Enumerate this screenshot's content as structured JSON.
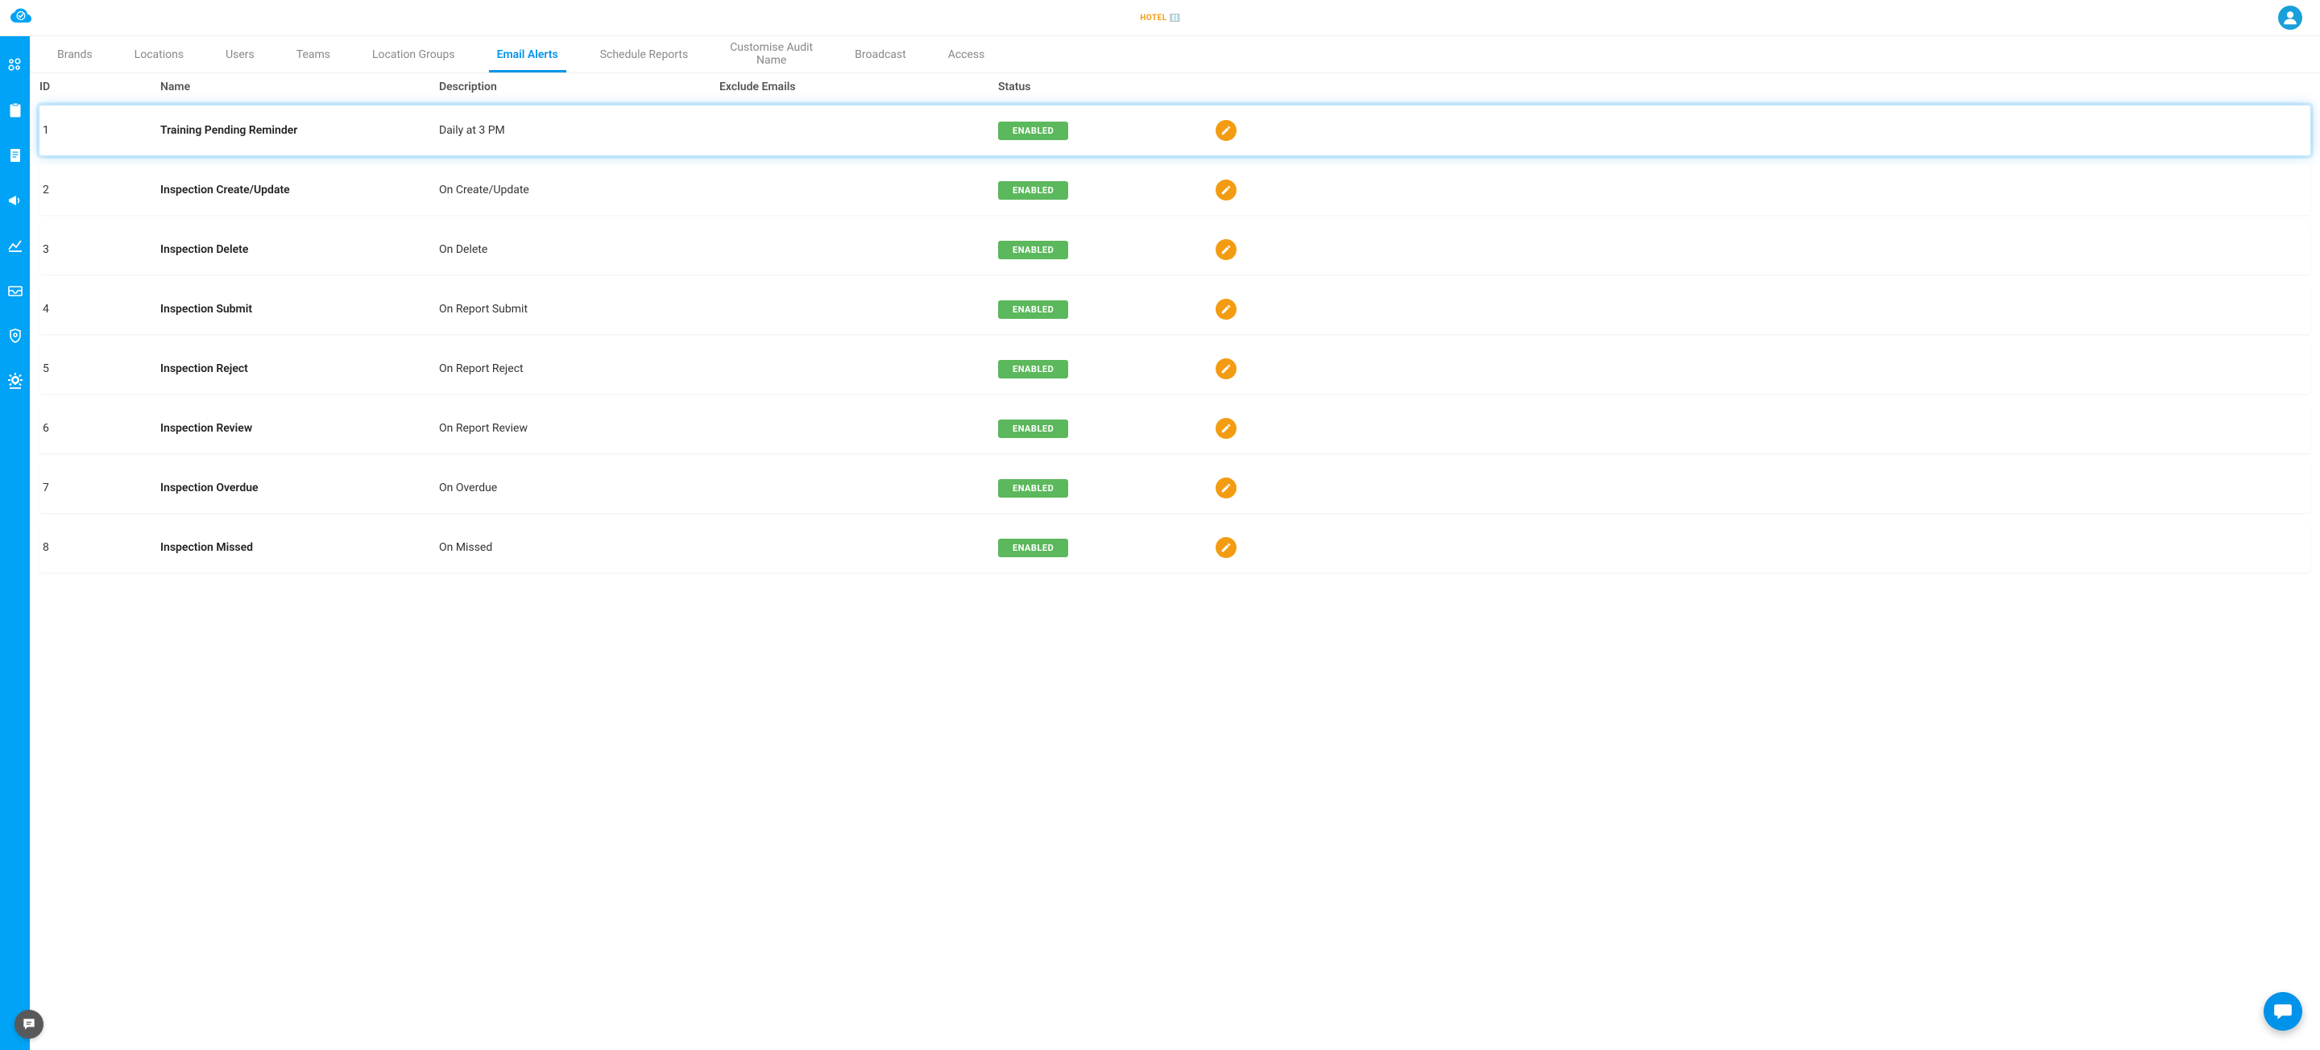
{
  "header": {
    "brand_text": "HOTEL"
  },
  "tabs": [
    {
      "key": "brands",
      "label": "Brands"
    },
    {
      "key": "locations",
      "label": "Locations"
    },
    {
      "key": "users",
      "label": "Users"
    },
    {
      "key": "teams",
      "label": "Teams"
    },
    {
      "key": "location-groups",
      "label": "Location Groups"
    },
    {
      "key": "email-alerts",
      "label": "Email Alerts",
      "active": true
    },
    {
      "key": "schedule-reports",
      "label": "Schedule Reports"
    },
    {
      "key": "customise-audit-name",
      "label": "Customise Audit\nName",
      "multiline": true
    },
    {
      "key": "broadcast",
      "label": "Broadcast"
    },
    {
      "key": "access",
      "label": "Access"
    }
  ],
  "columns": {
    "id": "ID",
    "name": "Name",
    "description": "Description",
    "exclude": "Exclude Emails",
    "status": "Status"
  },
  "status_label": "ENABLED",
  "rows": [
    {
      "id": "1",
      "name": "Training Pending Reminder",
      "description": "Daily at 3 PM",
      "exclude": "",
      "selected": true
    },
    {
      "id": "2",
      "name": "Inspection Create/Update",
      "description": "On Create/Update",
      "exclude": ""
    },
    {
      "id": "3",
      "name": "Inspection Delete",
      "description": "On Delete",
      "exclude": ""
    },
    {
      "id": "4",
      "name": "Inspection Submit",
      "description": "On Report Submit",
      "exclude": ""
    },
    {
      "id": "5",
      "name": "Inspection Reject",
      "description": "On Report Reject",
      "exclude": ""
    },
    {
      "id": "6",
      "name": "Inspection Review",
      "description": "On Report Review",
      "exclude": ""
    },
    {
      "id": "7",
      "name": "Inspection Overdue",
      "description": "On Overdue",
      "exclude": ""
    },
    {
      "id": "8",
      "name": "Inspection Missed",
      "description": "On Missed",
      "exclude": ""
    }
  ]
}
